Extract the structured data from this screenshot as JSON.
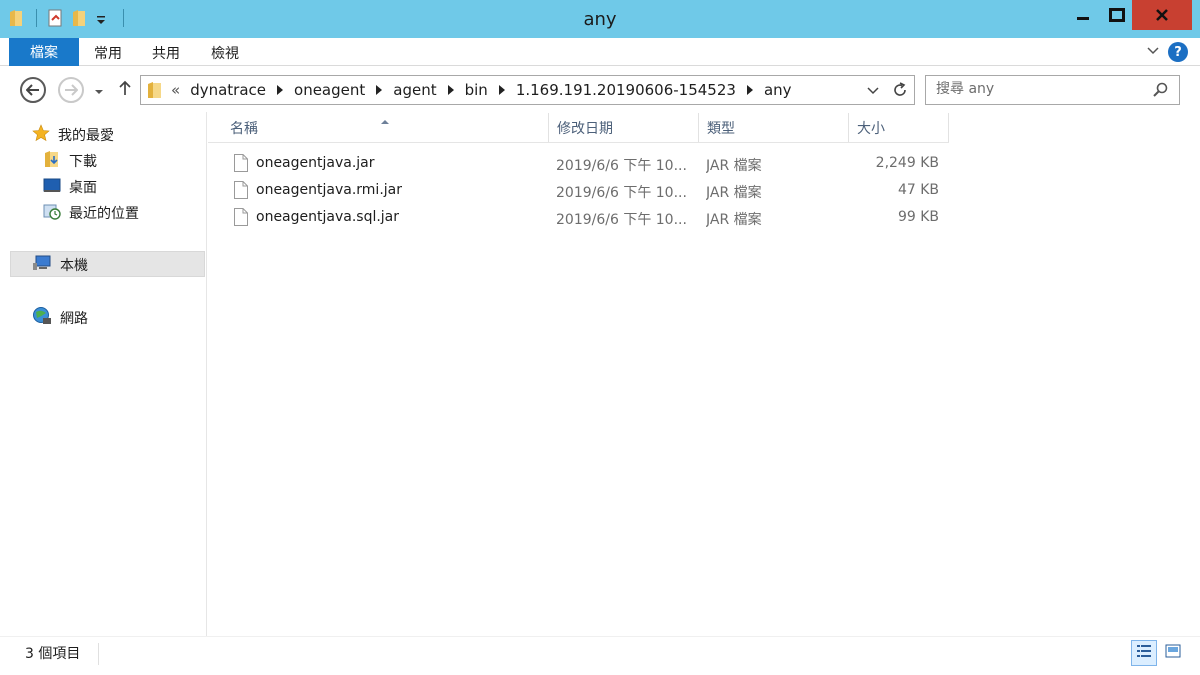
{
  "window": {
    "title": "any"
  },
  "ribbon": {
    "tabs": [
      "檔案",
      "常用",
      "共用",
      "檢視"
    ]
  },
  "address": {
    "overflow": "«",
    "crumbs": [
      "dynatrace",
      "oneagent",
      "agent",
      "bin",
      "1.169.191.20190606-154523",
      "any"
    ]
  },
  "search": {
    "placeholder": "搜尋 any"
  },
  "nav": {
    "favorites": "我的最愛",
    "downloads": "下載",
    "desktop": "桌面",
    "recent": "最近的位置",
    "this_pc": "本機",
    "network": "網路"
  },
  "columns": {
    "name": "名稱",
    "date": "修改日期",
    "type": "類型",
    "size": "大小"
  },
  "files": [
    {
      "name": "oneagentjava.jar",
      "date": "2019/6/6 下午 10...",
      "type": "JAR 檔案",
      "size": "2,249 KB"
    },
    {
      "name": "oneagentjava.rmi.jar",
      "date": "2019/6/6 下午 10...",
      "type": "JAR 檔案",
      "size": "47 KB"
    },
    {
      "name": "oneagentjava.sql.jar",
      "date": "2019/6/6 下午 10...",
      "type": "JAR 檔案",
      "size": "99 KB"
    }
  ],
  "status": {
    "count": "3 個項目"
  },
  "colors": {
    "titlebar": "#6fc9e8",
    "file_tab": "#1979ca",
    "close": "#c84031"
  }
}
